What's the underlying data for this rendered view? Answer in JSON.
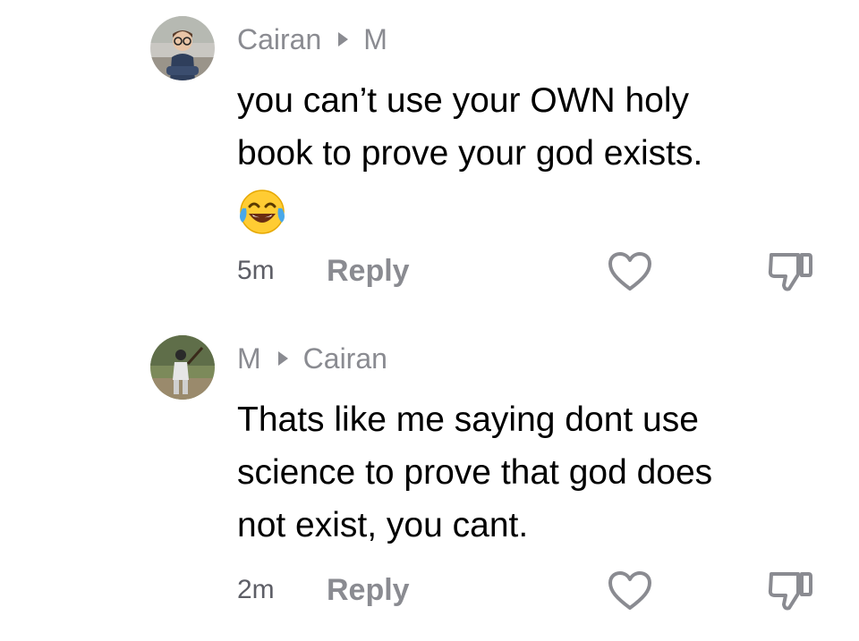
{
  "comments": [
    {
      "author": "Cairan",
      "reply_to": "M",
      "text_line1": "you can’t use your OWN holy",
      "text_line2": "book to prove your god exists.",
      "emoji": "face-with-tears-of-joy",
      "time": "5m",
      "reply_label": "Reply",
      "avatar": "avatar-boy-glasses"
    },
    {
      "author": "M",
      "reply_to": "Cairan",
      "text_line1": "Thats like me saying dont use",
      "text_line2": "science to prove that god does",
      "text_line3": "not exist, you cant.",
      "time": "2m",
      "reply_label": "Reply",
      "avatar": "avatar-baseball-player"
    }
  ],
  "icons": {
    "like": "heart-outline-icon",
    "dislike": "thumbs-down-outline-icon"
  },
  "colors": {
    "secondary_text": "#8a8b91",
    "icon_stroke": "#8a8b91",
    "body_text": "#000000"
  }
}
